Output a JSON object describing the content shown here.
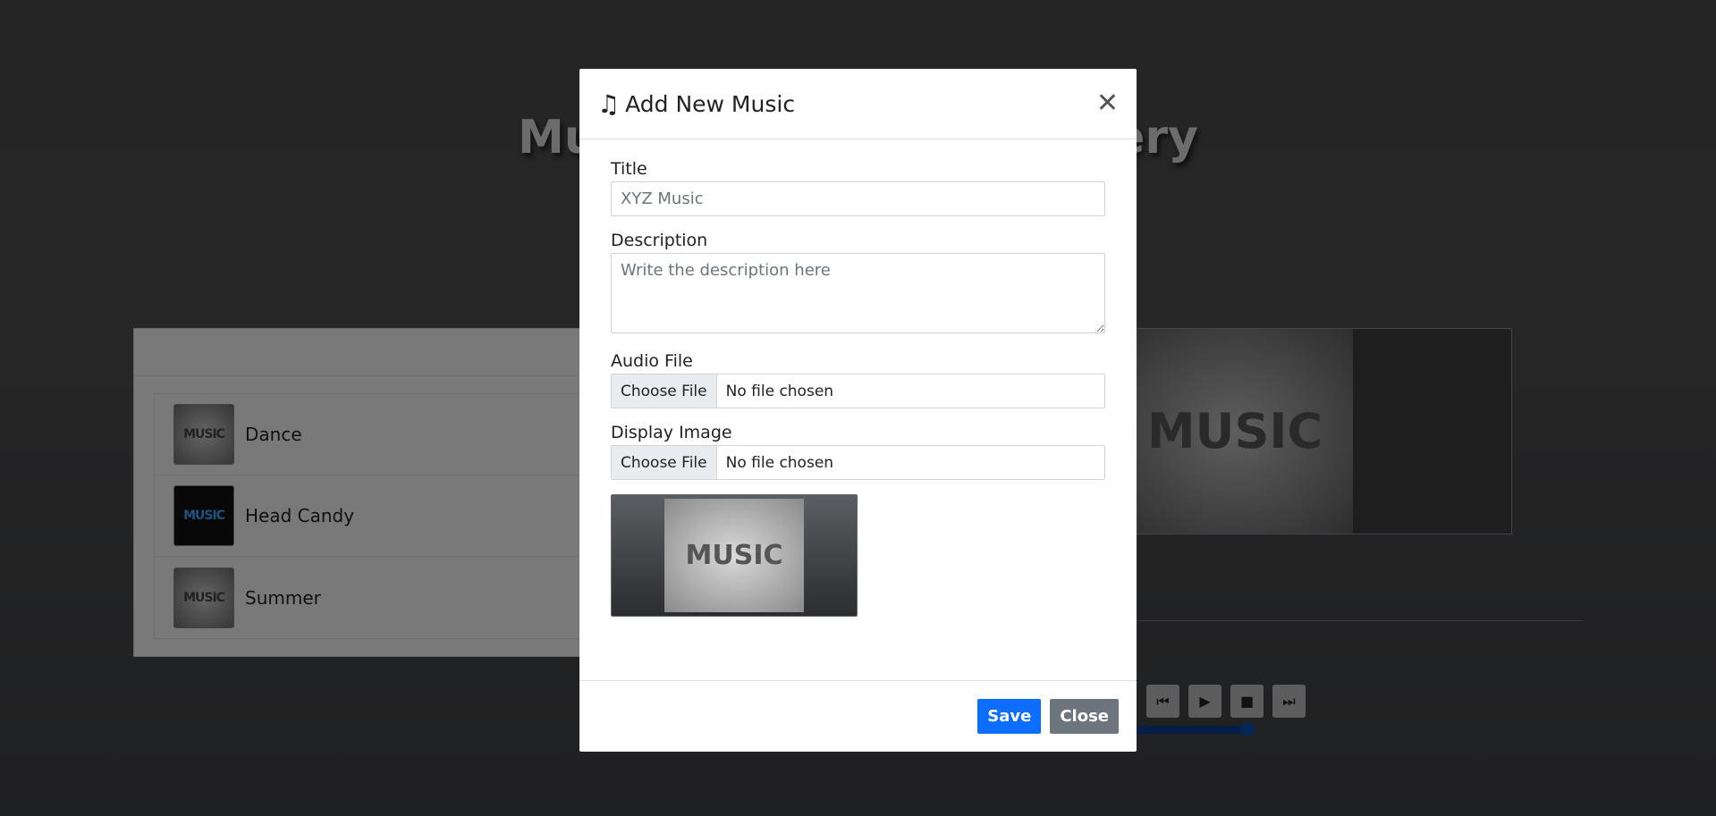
{
  "app": {
    "title": "Music Player using jQuery",
    "playlist": [
      {
        "name": "Dance",
        "thumb": "MUSIC",
        "style": "gray"
      },
      {
        "name": "Head Candy",
        "thumb": "MUSIC",
        "style": "dark"
      },
      {
        "name": "Summer",
        "thumb": "MUSIC",
        "style": "gray"
      }
    ],
    "preview_art_text": "MUSIC",
    "controls": {
      "prev_icon": "⏮",
      "play_icon": "▶",
      "stop_icon": "■",
      "next_icon": "⏭"
    }
  },
  "modal": {
    "title": "Add New Music",
    "title_icon": "music-note-icon",
    "close_symbol": "✕",
    "fields": {
      "title_label": "Title",
      "title_placeholder": "XYZ Music",
      "description_label": "Description",
      "description_placeholder": "Write the description here",
      "audio_label": "Audio File",
      "audio_button": "Choose File",
      "audio_status": "No file chosen",
      "image_label": "Display Image",
      "image_button": "Choose File",
      "image_status": "No file chosen",
      "preview_text": "MUSIC"
    },
    "buttons": {
      "save": "Save",
      "close": "Close"
    },
    "colors": {
      "save": "#0d6efd",
      "close": "#6c757d"
    }
  }
}
